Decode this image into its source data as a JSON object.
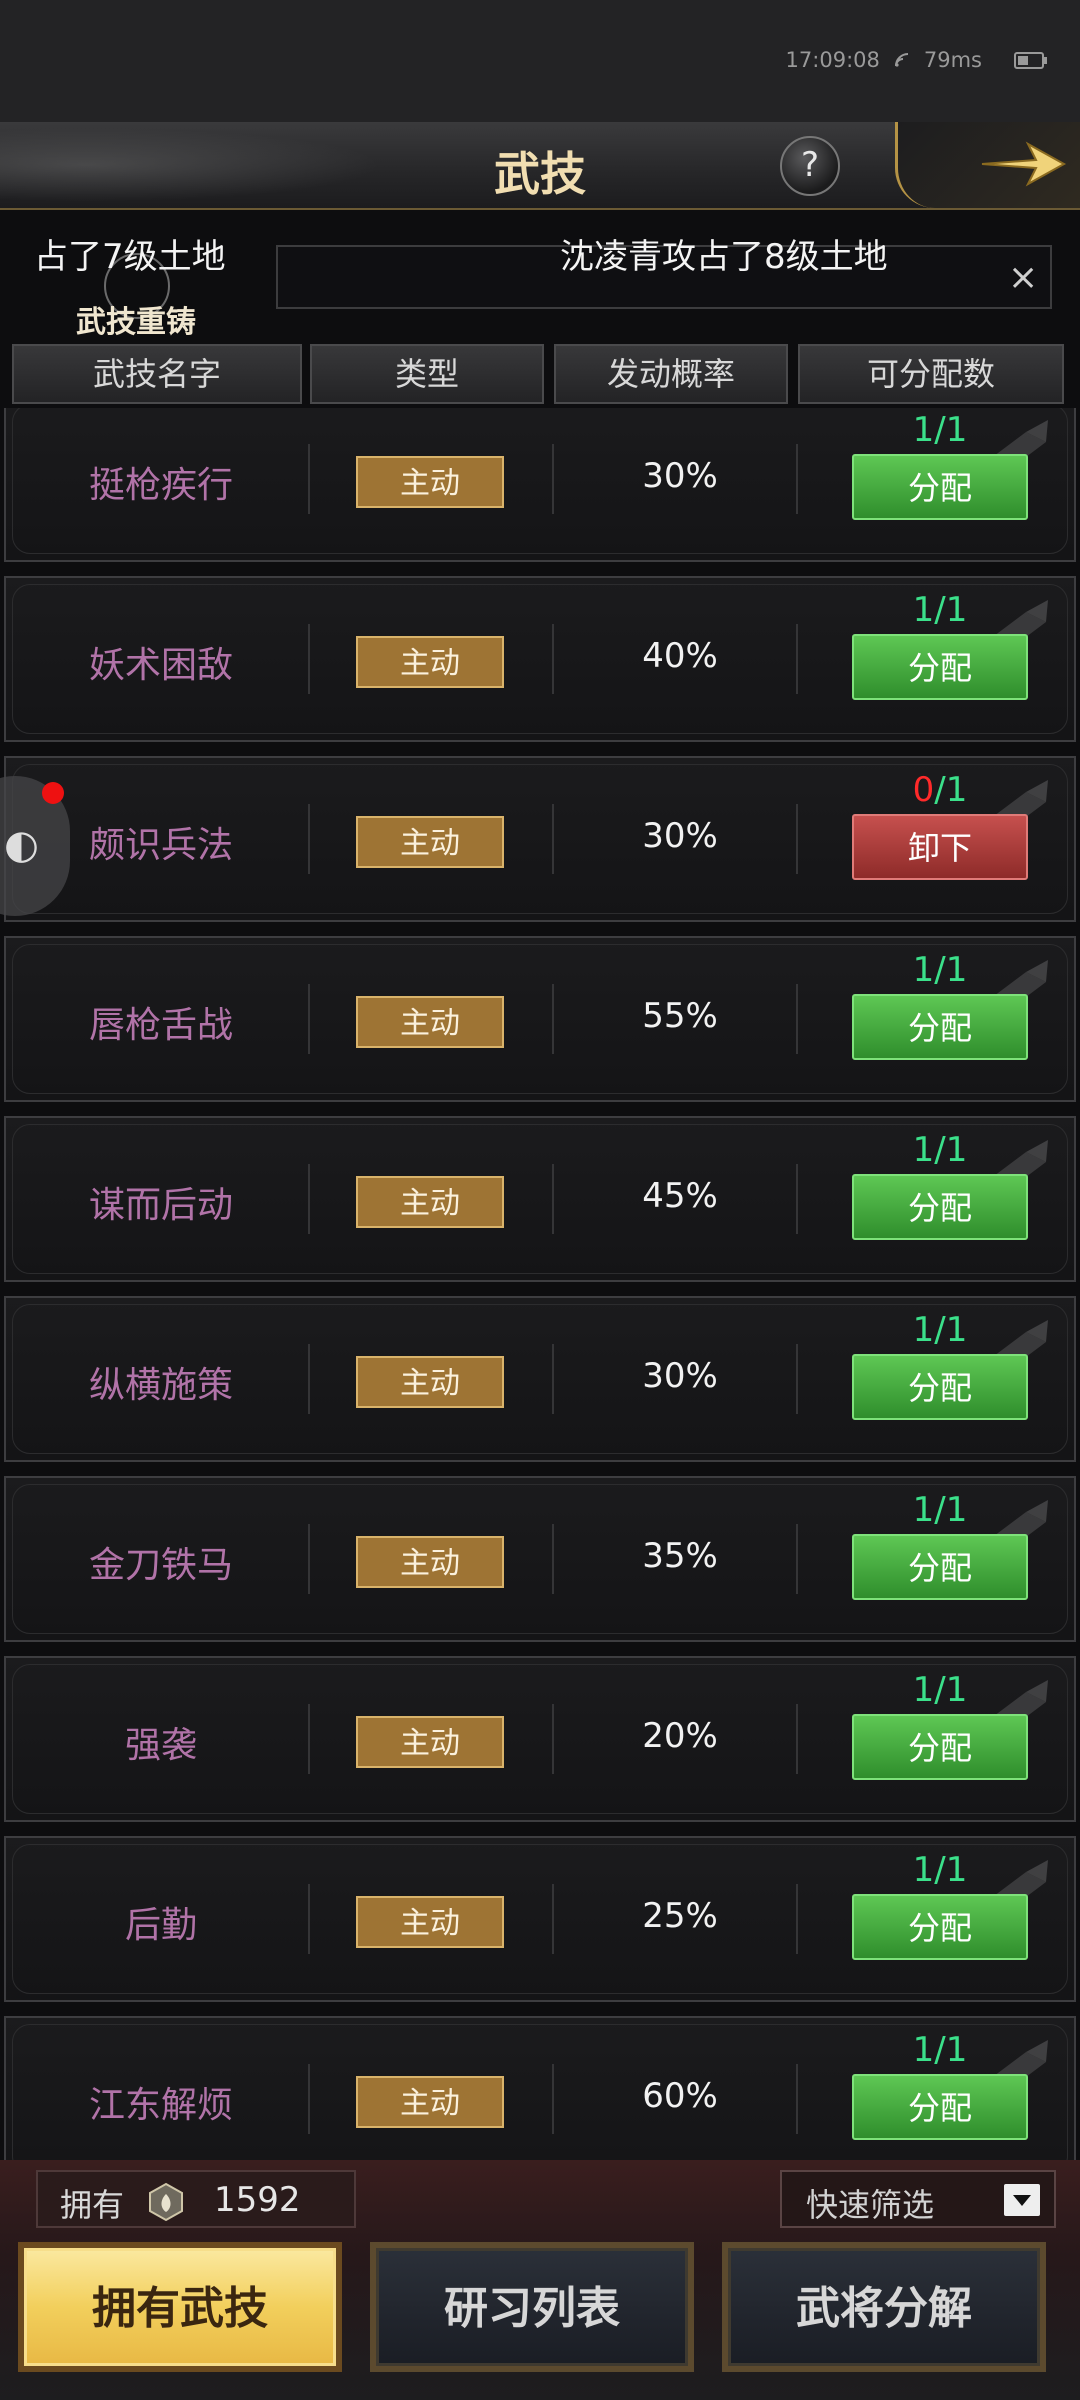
{
  "status_bar": {
    "time": "17:09:08",
    "latency": "79ms"
  },
  "header": {
    "title": "武技",
    "help": "?"
  },
  "broadcast": {
    "msg_left": "占了7级土地",
    "msg_right": "沈凌青攻占了8级土地",
    "close": "×",
    "overlay_label": "武技重铸"
  },
  "columns": [
    "武技名字",
    "类型",
    "发动概率",
    "可分配数"
  ],
  "rows": [
    {
      "name": "挺枪疾行",
      "type": "主动",
      "rate": "30%",
      "avail": "1",
      "total": "1",
      "action": "分配",
      "state": "assign"
    },
    {
      "name": "妖术困敌",
      "type": "主动",
      "rate": "40%",
      "avail": "1",
      "total": "1",
      "action": "分配",
      "state": "assign"
    },
    {
      "name": "颇识兵法",
      "type": "主动",
      "rate": "30%",
      "avail": "0",
      "total": "1",
      "action": "卸下",
      "state": "unload"
    },
    {
      "name": "唇枪舌战",
      "type": "主动",
      "rate": "55%",
      "avail": "1",
      "total": "1",
      "action": "分配",
      "state": "assign"
    },
    {
      "name": "谋而后动",
      "type": "主动",
      "rate": "45%",
      "avail": "1",
      "total": "1",
      "action": "分配",
      "state": "assign"
    },
    {
      "name": "纵横施策",
      "type": "主动",
      "rate": "30%",
      "avail": "1",
      "total": "1",
      "action": "分配",
      "state": "assign"
    },
    {
      "name": "金刀铁马",
      "type": "主动",
      "rate": "35%",
      "avail": "1",
      "total": "1",
      "action": "分配",
      "state": "assign"
    },
    {
      "name": "强袭",
      "type": "主动",
      "rate": "20%",
      "avail": "1",
      "total": "1",
      "action": "分配",
      "state": "assign"
    },
    {
      "name": "后勤",
      "type": "主动",
      "rate": "25%",
      "avail": "1",
      "total": "1",
      "action": "分配",
      "state": "assign"
    },
    {
      "name": "江东解烦",
      "type": "主动",
      "rate": "60%",
      "avail": "1",
      "total": "1",
      "action": "分配",
      "state": "assign"
    }
  ],
  "footer": {
    "owned_label": "拥有",
    "owned_value": "1592",
    "filter_label": "快速筛选",
    "tabs": [
      "拥有武技",
      "研习列表",
      "武将分解"
    ],
    "active_tab": 0
  },
  "colors": {
    "green": "#3be08a",
    "red": "#ff2a2a",
    "name": "#b173a8",
    "gold": "#d9b36a"
  }
}
